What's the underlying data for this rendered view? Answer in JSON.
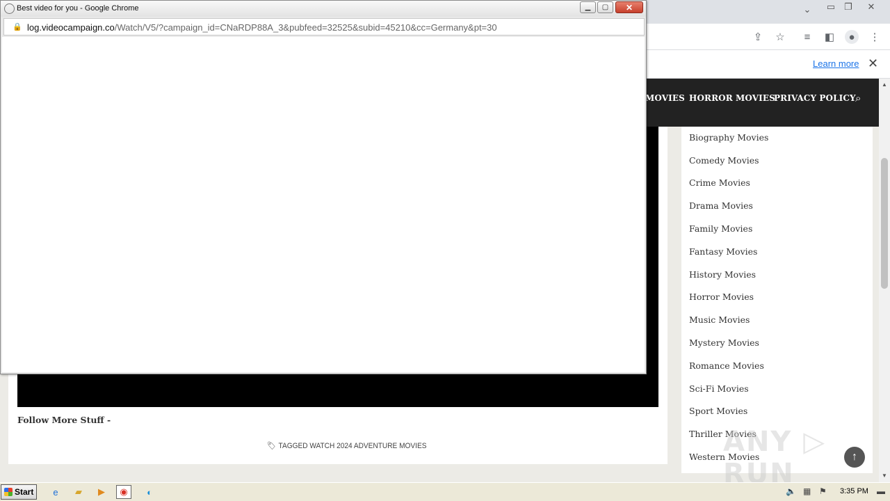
{
  "background_browser": {
    "infobar": {
      "learn_more": "Learn more"
    },
    "site_nav": {
      "items": [
        "MOVIES",
        "HORROR MOVIES",
        "PRIVACY POLICY"
      ]
    },
    "content": {
      "follow_text": "Follow More Stuff -",
      "tag_line": "TAGGED WATCH 2024 ADVENTURE MOVIES"
    },
    "sidebar": {
      "categories": [
        "Biography Movies",
        "Comedy Movies",
        "Crime Movies",
        "Drama Movies",
        "Family Movies",
        "Fantasy Movies",
        "History Movies",
        "Horror Movies",
        "Music Movies",
        "Mystery Movies",
        "Romance Movies",
        "Sci-Fi Movies",
        "Sport Movies",
        "Thriller Movies",
        "Western Movies"
      ]
    },
    "watermark": "ANY RUN"
  },
  "popup": {
    "title": "Best video for you - Google Chrome",
    "url_host": "log.videocampaign.co",
    "url_path": "/Watch/V5/?campaign_id=CNaRDP88A_3&pubfeed=32525&subid=45210&cc=Germany&pt=30"
  },
  "taskbar": {
    "start_label": "Start",
    "clock": "3:35 PM"
  }
}
